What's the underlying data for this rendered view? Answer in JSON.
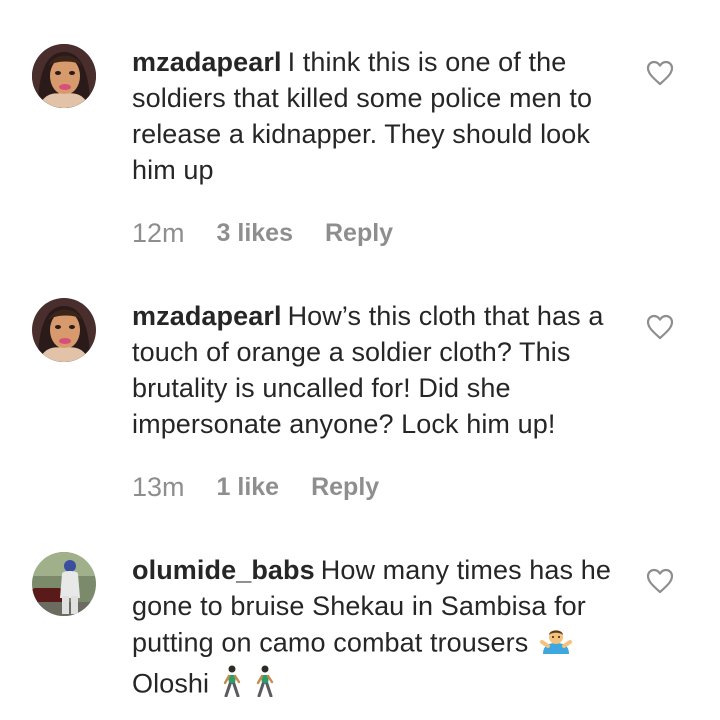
{
  "comments": [
    {
      "username": "mzadapearl",
      "text": "I think this is one of the soldiers that killed some police men to release a kidnapper. They should look him up",
      "time": "12m",
      "likes": "3 likes",
      "reply": "Reply"
    },
    {
      "username": "mzadapearl",
      "text": "How’s this cloth that has a touch of orange a soldier cloth? This brutality is uncalled for! Did she impersonate anyone? Lock him up!",
      "time": "13m",
      "likes": "1 like",
      "reply": "Reply"
    },
    {
      "username": "olumide_babs",
      "text": "How many times has he gone to bruise Shekau in Sambisa for putting on camo combat trousers",
      "text_end": "Oloshi",
      "emojis": [
        "person-shrugging-emoji",
        "person-walking-emoji",
        "person-walking-emoji"
      ]
    }
  ],
  "icons": {
    "like": "heart-outline-icon"
  },
  "colors": {
    "text": "#262626",
    "meta": "#8e8e8e",
    "heart": "#8e8e8e"
  }
}
